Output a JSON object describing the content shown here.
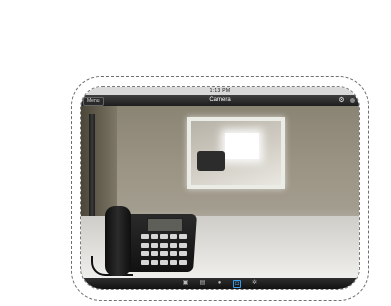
{
  "status_bar": {
    "time": "1:13 PM"
  },
  "nav_bar": {
    "back_label": "Menu",
    "title": "Camera"
  },
  "tab_bar": {
    "items": [
      {
        "icon": "image-icon",
        "glyph": "▣"
      },
      {
        "icon": "document-icon",
        "glyph": "▤"
      },
      {
        "icon": "circle-icon",
        "glyph": "●"
      },
      {
        "icon": "camera-icon",
        "glyph": "◘",
        "active": true
      },
      {
        "icon": "settings-icon",
        "glyph": "✲"
      }
    ]
  },
  "colors": {
    "active_tab": "#3a9be8",
    "bar_dark": "#1d1d1d"
  }
}
